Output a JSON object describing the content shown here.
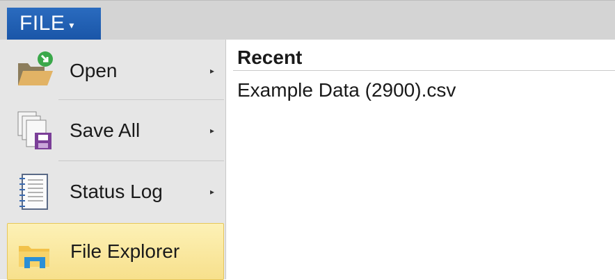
{
  "file_menu": {
    "label": "FILE",
    "caret": "▾"
  },
  "menu": {
    "items": [
      {
        "label": "Open",
        "icon": "open-folder-icon",
        "arrow": "▸"
      },
      {
        "label": "Save All",
        "icon": "save-all-icon",
        "arrow": "▸"
      },
      {
        "label": "Status Log",
        "icon": "status-log-icon",
        "arrow": "▸"
      },
      {
        "label": "File Explorer",
        "icon": "file-explorer-icon"
      }
    ]
  },
  "recent": {
    "title": "Recent",
    "items": [
      "Example Data (2900).csv"
    ]
  },
  "colors": {
    "file_button": "#1a56a8",
    "highlight": "#f7e08c",
    "sidebar_bg": "#e6e6e6",
    "topbar_bg": "#d4d4d4"
  }
}
